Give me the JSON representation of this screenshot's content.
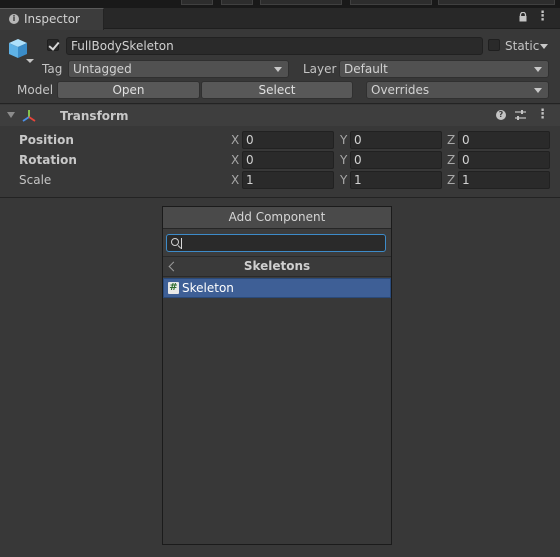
{
  "window": {
    "tab_label": "Inspector"
  },
  "header": {
    "object_name": "FullBodySkeleton",
    "static_label": "Static",
    "tag_label": "Tag",
    "tag_value": "Untagged",
    "layer_label": "Layer",
    "layer_value": "Default",
    "model_label": "Model",
    "open_button": "Open",
    "select_button": "Select",
    "overrides_value": "Overrides"
  },
  "transform": {
    "title": "Transform",
    "rows": [
      {
        "label": "Position",
        "x": "0",
        "y": "0",
        "z": "0"
      },
      {
        "label": "Rotation",
        "x": "0",
        "y": "0",
        "z": "0"
      },
      {
        "label": "Scale",
        "x": "1",
        "y": "1",
        "z": "1"
      }
    ],
    "axis": {
      "x": "X",
      "y": "Y",
      "z": "Z"
    }
  },
  "add_component": {
    "button_label": "Add Component",
    "search_value": "",
    "breadcrumb": "Skeletons",
    "items": [
      {
        "label": "Skeleton",
        "icon": "script-hash-icon"
      }
    ]
  },
  "colors": {
    "selection": "#3e5f96",
    "search_focus": "#3d8bc9",
    "background": "#383838"
  }
}
